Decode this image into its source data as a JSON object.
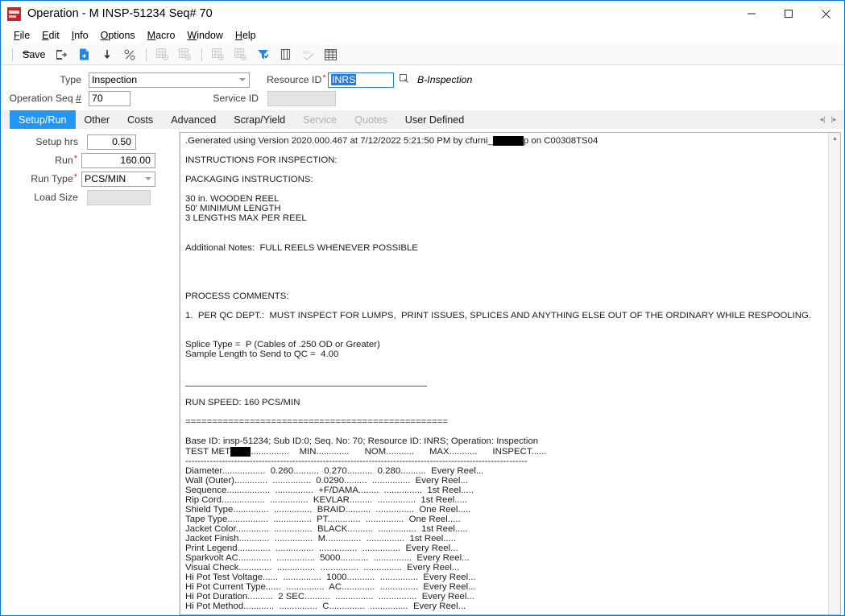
{
  "window": {
    "title": "Operation - M INSP-51234 Seq# 70",
    "logo_icon": "app-logo-icon",
    "minimize_label": "Minimize",
    "maximize_label": "Maximize",
    "close_label": "Close"
  },
  "menubar": {
    "items": [
      {
        "label": "File",
        "accel": "F"
      },
      {
        "label": "Edit",
        "accel": "E"
      },
      {
        "label": "Info",
        "accel": "I"
      },
      {
        "label": "Options",
        "accel": "O"
      },
      {
        "label": "Macro",
        "accel": "M"
      },
      {
        "label": "Window",
        "accel": "W"
      },
      {
        "label": "Help",
        "accel": "H"
      }
    ]
  },
  "toolbar": {
    "save_label": "Save",
    "buttons": [
      {
        "name": "save-button",
        "label": "Save",
        "enabled": true
      },
      {
        "name": "exit-button",
        "label": "Exit",
        "enabled": true
      },
      {
        "name": "new-document-button",
        "label": "New",
        "enabled": true
      },
      {
        "name": "insert-down-button",
        "label": "Insert",
        "enabled": true
      },
      {
        "name": "percent-button",
        "label": "Percent",
        "enabled": true
      },
      {
        "name": "grid-add-1-button",
        "label": "Add Row",
        "enabled": false
      },
      {
        "name": "grid-add-2-button",
        "label": "Add Column",
        "enabled": false
      },
      {
        "name": "grid-add-3-button",
        "label": "Insert Row",
        "enabled": false
      },
      {
        "name": "grid-add-4-button",
        "label": "Insert Column",
        "enabled": false
      },
      {
        "name": "filter-button",
        "label": "Filter",
        "enabled": true
      },
      {
        "name": "delete-button",
        "label": "Delete",
        "enabled": true
      },
      {
        "name": "spellcheck-button",
        "label": "Spell Check",
        "enabled": false
      },
      {
        "name": "table-view-button",
        "label": "Table View",
        "enabled": true
      }
    ]
  },
  "header_form": {
    "type_label": "Type",
    "type_accel": "",
    "type_value": "Inspection",
    "operation_seq_label": "Operation Seq #",
    "operation_seq_value": "70",
    "resource_id_label": "Resource ID",
    "resource_id_value": "INRS",
    "resource_id_required": "*",
    "resource_id_note": "B-Inspection",
    "service_id_label": "Service ID",
    "service_id_value": ""
  },
  "tabs": [
    {
      "label": "Setup/Run",
      "state": "active"
    },
    {
      "label": "Other",
      "state": "normal"
    },
    {
      "label": "Costs",
      "state": "normal"
    },
    {
      "label": "Advanced",
      "state": "normal"
    },
    {
      "label": "Scrap/Yield",
      "state": "normal"
    },
    {
      "label": "Service",
      "state": "disabled"
    },
    {
      "label": "Quotes",
      "state": "disabled"
    },
    {
      "label": "User Defined",
      "state": "normal"
    }
  ],
  "tab_scroll": {
    "prev_icon": "chevron-left-icon",
    "next_icon": "chevron-right-icon"
  },
  "setup_run": {
    "setup_hrs_label": "Setup hrs",
    "setup_hrs_value": "0.50",
    "run_label": "Run",
    "run_value": "160.00",
    "run_required": "*",
    "run_type_label": "Run Type",
    "run_type_value": "PCS/MIN",
    "run_type_required": "*",
    "load_size_label": "Load Size",
    "load_size_value": ""
  },
  "memo": {
    "generated_line": ".Generated using Version 2020.000.467 at 7/12/2022 5:21:50 PM by cfurni_",
    "generated_redacted": "XXXXX",
    "generated_tail": "p on C00308TS04",
    "lines": [
      "INSTRUCTIONS FOR INSPECTION:",
      "",
      "PACKAGING INSTRUCTIONS:",
      "",
      "30 in. WOODEN REEL",
      "50' MINIMUM LENGTH",
      "3 LENGTHS MAX PER REEL",
      "",
      "",
      "Additional Notes:  FULL REELS WHENEVER POSSIBLE",
      "",
      "",
      "",
      "",
      "PROCESS COMMENTS:",
      "",
      "1.  PER QC DEPT.:  MUST INSPECT FOR LUMPS,  PRINT ISSUES, SPLICES AND ANYTHING ELSE OUT OF THE ORDINARY WHILE RESPOOLING.",
      "",
      "",
      "Splice Type =  P (Cables of .250 OD or Greater)",
      "Sample Length to Send to QC =  4.00"
    ],
    "divider_rule": "______________________________________",
    "run_speed_line": "RUN SPEED: 160 PCS/MIN",
    "equals_rule": "=================================================",
    "base_id_line": "Base ID: insp-51234; Sub ID:0; Seq. No: 70; Resource ID: INRS; Operation: Inspection",
    "table": {
      "header": {
        "test_method": "TEST MET",
        "test_method_redacted": "HOD",
        "test_method_dots": "...............",
        "min": "MIN.............",
        "nom": "NOM...........",
        "max": "MAX...........",
        "inspect": "INSPECT......"
      },
      "dash_rule": "-----------------------------------------------------------------------------------------------------------------",
      "rows": [
        {
          "test": "Diameter",
          "min": "0.260",
          "nom": "0.270",
          "max": "0.280",
          "inspect": "Every Reel"
        },
        {
          "test": "Wall (Outer)",
          "min": "",
          "nom": "0.0290",
          "max": "",
          "inspect": "Every Reel"
        },
        {
          "test": "Sequence",
          "min": "",
          "nom": "+F/DAMA",
          "max": "",
          "inspect": "1st Reel"
        },
        {
          "test": "Rip Cord",
          "min": "",
          "nom": "KEVLAR",
          "max": "",
          "inspect": "1st Reel"
        },
        {
          "test": "Shield Type",
          "min": "",
          "nom": "BRAID",
          "max": "",
          "inspect": "One Reel"
        },
        {
          "test": "Tape Type",
          "min": "",
          "nom": "PT",
          "max": "",
          "inspect": "One Reel"
        },
        {
          "test": "Jacket Color",
          "min": "",
          "nom": "BLACK",
          "max": "",
          "inspect": "1st Reel"
        },
        {
          "test": "Jacket Finish",
          "min": "",
          "nom": "M",
          "max": "",
          "inspect": "1st Reel"
        },
        {
          "test": "Print Legend",
          "min": "",
          "nom": "",
          "max": "",
          "inspect": "Every Reel"
        },
        {
          "test": "Sparkvolt AC",
          "min": "",
          "nom": "5000",
          "max": "",
          "inspect": "Every Reel"
        },
        {
          "test": "Visual Check",
          "min": "",
          "nom": "",
          "max": "",
          "inspect": "Every Reel"
        },
        {
          "test": "Hi Pot Test Voltage",
          "min": "",
          "nom": "1000",
          "max": "",
          "inspect": "Every Reel"
        },
        {
          "test": "Hi Pot Current Type",
          "min": "",
          "nom": "AC",
          "max": "",
          "inspect": "Every Reel"
        },
        {
          "test": "Hi Pot Duration",
          "min": "2 SEC",
          "nom": "",
          "max": "",
          "inspect": "Every Reel"
        },
        {
          "test": "Hi Pot Method",
          "min": "",
          "nom": "C",
          "max": "",
          "inspect": "Every Reel"
        }
      ]
    }
  },
  "scrollbar": {
    "up_icon": "scroll-up-icon",
    "down_icon": "scroll-down-icon"
  },
  "colors": {
    "accent": "#2196f3",
    "window_border": "#0078d7",
    "required": "#e81123",
    "logo": "#cc2127",
    "selection": "#2b7cd3"
  }
}
